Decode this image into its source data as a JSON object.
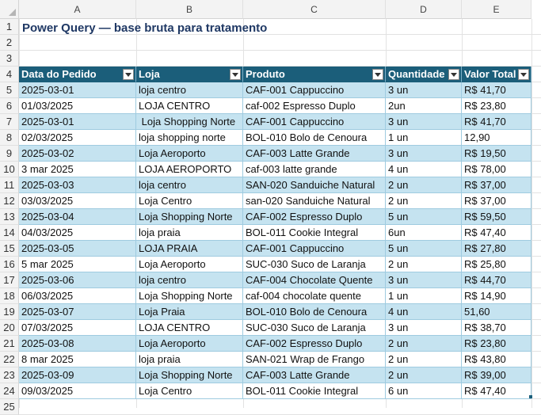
{
  "columns": [
    "A",
    "B",
    "C",
    "D",
    "E"
  ],
  "rows": [
    "1",
    "2",
    "3",
    "4",
    "5",
    "6",
    "7",
    "8",
    "9",
    "10",
    "11",
    "12",
    "13",
    "14",
    "15",
    "16",
    "17",
    "18",
    "19",
    "20",
    "21",
    "22",
    "23",
    "24",
    "25"
  ],
  "title": "Power Query — base bruta para tratamento",
  "table": {
    "headers": [
      "Data do Pedido",
      "Loja",
      "Produto",
      "Quantidade",
      "Valor Total"
    ],
    "rows": [
      [
        "2025-03-01",
        "loja centro",
        "CAF-001 Cappuccino",
        "3 un",
        "R$ 41,70"
      ],
      [
        "01/03/2025",
        "LOJA CENTRO",
        "caf-002 Espresso Duplo",
        "2un",
        "R$ 23,80"
      ],
      [
        "2025-03-01",
        " Loja Shopping Norte",
        "CAF-001 Cappuccino",
        "3 un",
        "R$ 41,70"
      ],
      [
        "02/03/2025",
        "loja shopping norte",
        "BOL-010 Bolo de Cenoura",
        "1 un",
        "12,90"
      ],
      [
        "2025-03-02",
        "Loja Aeroporto",
        "CAF-003 Latte Grande",
        "3 un",
        "R$ 19,50"
      ],
      [
        "3 mar 2025",
        "LOJA AEROPORTO",
        "caf-003 latte grande",
        "4 un",
        "R$ 78,00"
      ],
      [
        "2025-03-03",
        "loja centro",
        "SAN-020 Sanduiche Natural",
        "2 un",
        "R$ 37,00"
      ],
      [
        "03/03/2025",
        "Loja Centro",
        "san-020 Sanduiche Natural",
        "2 un",
        "R$ 37,00"
      ],
      [
        "2025-03-04",
        "Loja Shopping Norte",
        "CAF-002 Espresso Duplo",
        "5 un",
        "R$ 59,50"
      ],
      [
        "04/03/2025",
        "loja praia",
        "BOL-011 Cookie Integral",
        "6un",
        "R$ 47,40"
      ],
      [
        "2025-03-05",
        "LOJA PRAIA",
        "CAF-001 Cappuccino",
        "5 un",
        "R$ 27,80"
      ],
      [
        "5 mar 2025",
        "Loja Aeroporto",
        "SUC-030 Suco de Laranja",
        "2 un",
        "R$ 25,80"
      ],
      [
        "2025-03-06",
        "loja centro",
        "CAF-004 Chocolate Quente",
        "3 un",
        "R$ 44,70"
      ],
      [
        "06/03/2025",
        "Loja Shopping Norte",
        "caf-004 chocolate quente",
        "1 un",
        "R$ 14,90"
      ],
      [
        "2025-03-07",
        "Loja Praia",
        "BOL-010 Bolo de Cenoura",
        "4 un",
        "51,60"
      ],
      [
        "07/03/2025",
        "LOJA CENTRO",
        "SUC-030 Suco de Laranja",
        "3 un",
        "R$ 38,70"
      ],
      [
        "2025-03-08",
        "Loja Aeroporto",
        "CAF-002 Espresso Duplo",
        "2 un",
        "R$ 23,80"
      ],
      [
        "8 mar 2025",
        "loja praia",
        "SAN-021 Wrap de Frango",
        "2 un",
        "R$ 43,80"
      ],
      [
        "2025-03-09",
        "Loja Shopping Norte",
        "CAF-003 Latte Grande",
        "2 un",
        "R$ 39,00"
      ],
      [
        "09/03/2025",
        "Loja Centro",
        "BOL-011 Cookie Integral",
        "6 un",
        "R$ 47,40"
      ]
    ]
  }
}
